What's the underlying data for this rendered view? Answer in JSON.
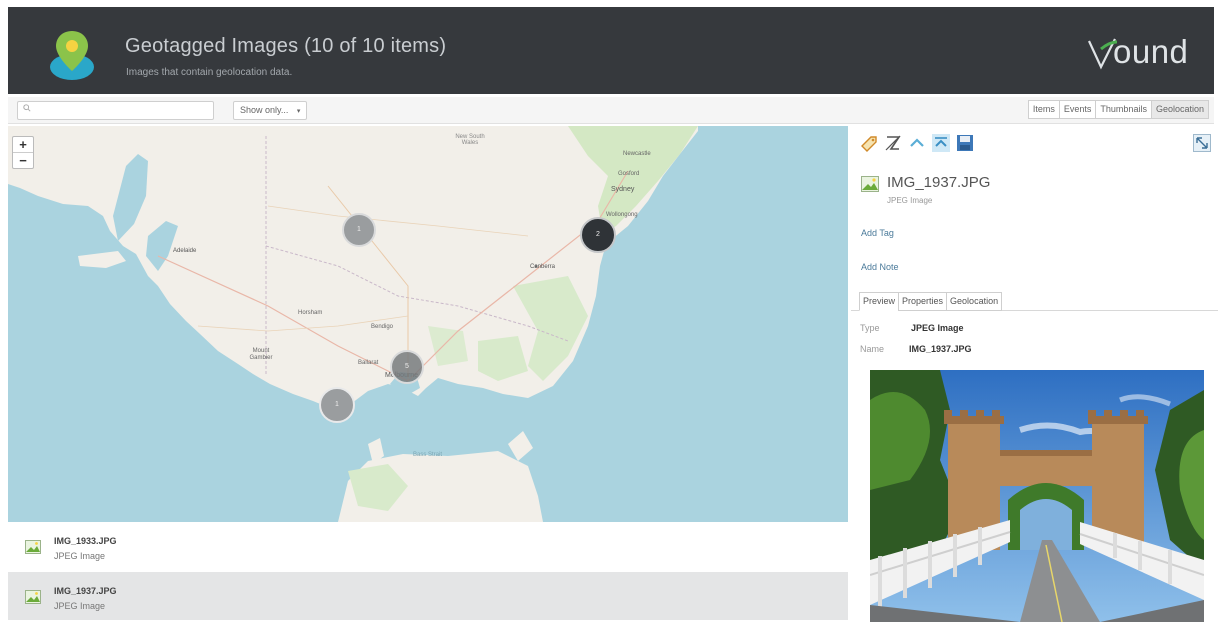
{
  "header": {
    "title": "Geotagged Images (10 of 10 items)",
    "subtitle": "Images that contain geolocation data.",
    "brand": "ound",
    "brand_v": "V"
  },
  "toolbar": {
    "search_placeholder": "",
    "show_only": "Show only...",
    "views": [
      "Items",
      "Events",
      "Thumbnails",
      "Geolocation"
    ],
    "active_view": "Geolocation"
  },
  "map": {
    "zoom_in": "+",
    "zoom_out": "−",
    "places": {
      "new_south_wales": "New South Wales",
      "newcastle": "Newcastle",
      "gosford": "Gosford",
      "sydney": "Sydney",
      "wollongong": "Wollongong",
      "adelaide": "Adelaide",
      "canberra": "Canberra",
      "horsham": "Horsham",
      "bendigo": "Bendigo",
      "mount_gambier": "Mount Gambier",
      "ballarat": "Ballarat",
      "melbourne": "Melbourne",
      "bass_strait": "Bass Strait"
    },
    "clusters": [
      {
        "label": "1"
      },
      {
        "label": "2"
      },
      {
        "label": "5"
      },
      {
        "label": "1"
      }
    ]
  },
  "list": {
    "items": [
      {
        "name": "IMG_1933.JPG",
        "type": "JPEG Image",
        "selected": false
      },
      {
        "name": "IMG_1937.JPG",
        "type": "JPEG Image",
        "selected": true
      }
    ]
  },
  "panel": {
    "title": "IMG_1937.JPG",
    "subtitle": "JPEG Image",
    "add_tag": "Add Tag",
    "add_note": "Add Note",
    "tabs": [
      "Preview",
      "Properties",
      "Geolocation"
    ],
    "active_tab": "Preview",
    "props": {
      "type_label": "Type",
      "type_value": "JPEG Image",
      "name_label": "Name",
      "name_value": "IMG_1937.JPG"
    }
  },
  "colors": {
    "header_bg": "#36393d",
    "brand_accent": "#4caf50",
    "sea": "#aad3df",
    "land": "#f2efe9",
    "cluster_dark": "#2f3337",
    "cluster_gray": "#9a9d9f"
  }
}
